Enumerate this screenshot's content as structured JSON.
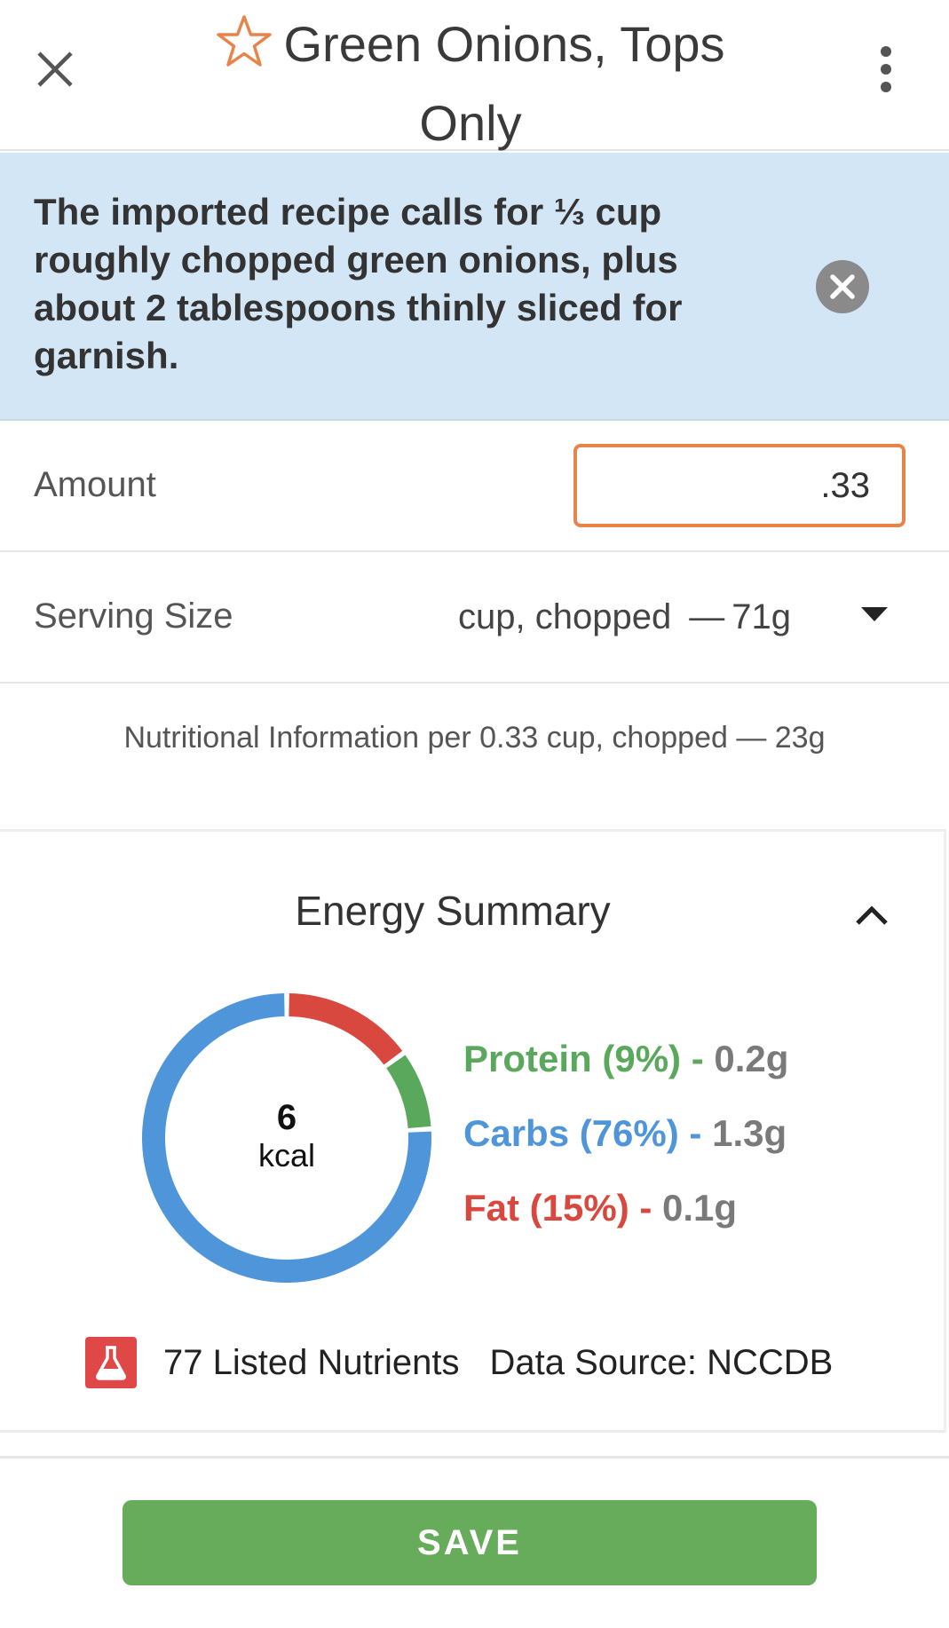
{
  "header": {
    "title_line1": "Green Onions, Tops",
    "title_line2": "Only",
    "close_icon": "close-icon",
    "favorite_icon": "star-outline-icon",
    "more_icon": "more-vertical-icon"
  },
  "banner": {
    "text": "The imported recipe calls for ⅓ cup roughly chopped green onions, plus about 2 tablespoons thinly sliced for garnish.",
    "dismiss_icon": "close-circle-icon",
    "background_color": "#d3e6f5"
  },
  "amount": {
    "label": "Amount",
    "value": ".33",
    "border_color": "#e8844a"
  },
  "serving": {
    "label": "Serving Size",
    "value": "cup, chopped",
    "dash": "—",
    "grams": "71g",
    "dropdown_icon": "caret-down-icon"
  },
  "nutrition_info": "Nutritional Information per 0.33 cup, chopped  — 23g",
  "energy": {
    "title": "Energy Summary",
    "collapse_icon": "chevron-up-icon",
    "kcal_value": "6",
    "kcal_unit": "kcal",
    "macros": [
      {
        "label": "Protein (9%)",
        "sep": " - ",
        "amount": "0.2g",
        "percent": 9,
        "color": "#5aa85c"
      },
      {
        "label": "Carbs (76%)",
        "sep": " - ",
        "amount": "1.3g",
        "percent": 76,
        "color": "#4f95d9"
      },
      {
        "label": "Fat (15%)",
        "sep": " - ",
        "amount": "0.1g",
        "percent": 15,
        "color": "#d9483f"
      }
    ],
    "nutrients_icon": "flask-icon",
    "nutrients_text": "77 Listed Nutrients",
    "data_source": "Data Source: NCCDB"
  },
  "save_label": "SAVE",
  "save_color": "#66ac5b"
}
